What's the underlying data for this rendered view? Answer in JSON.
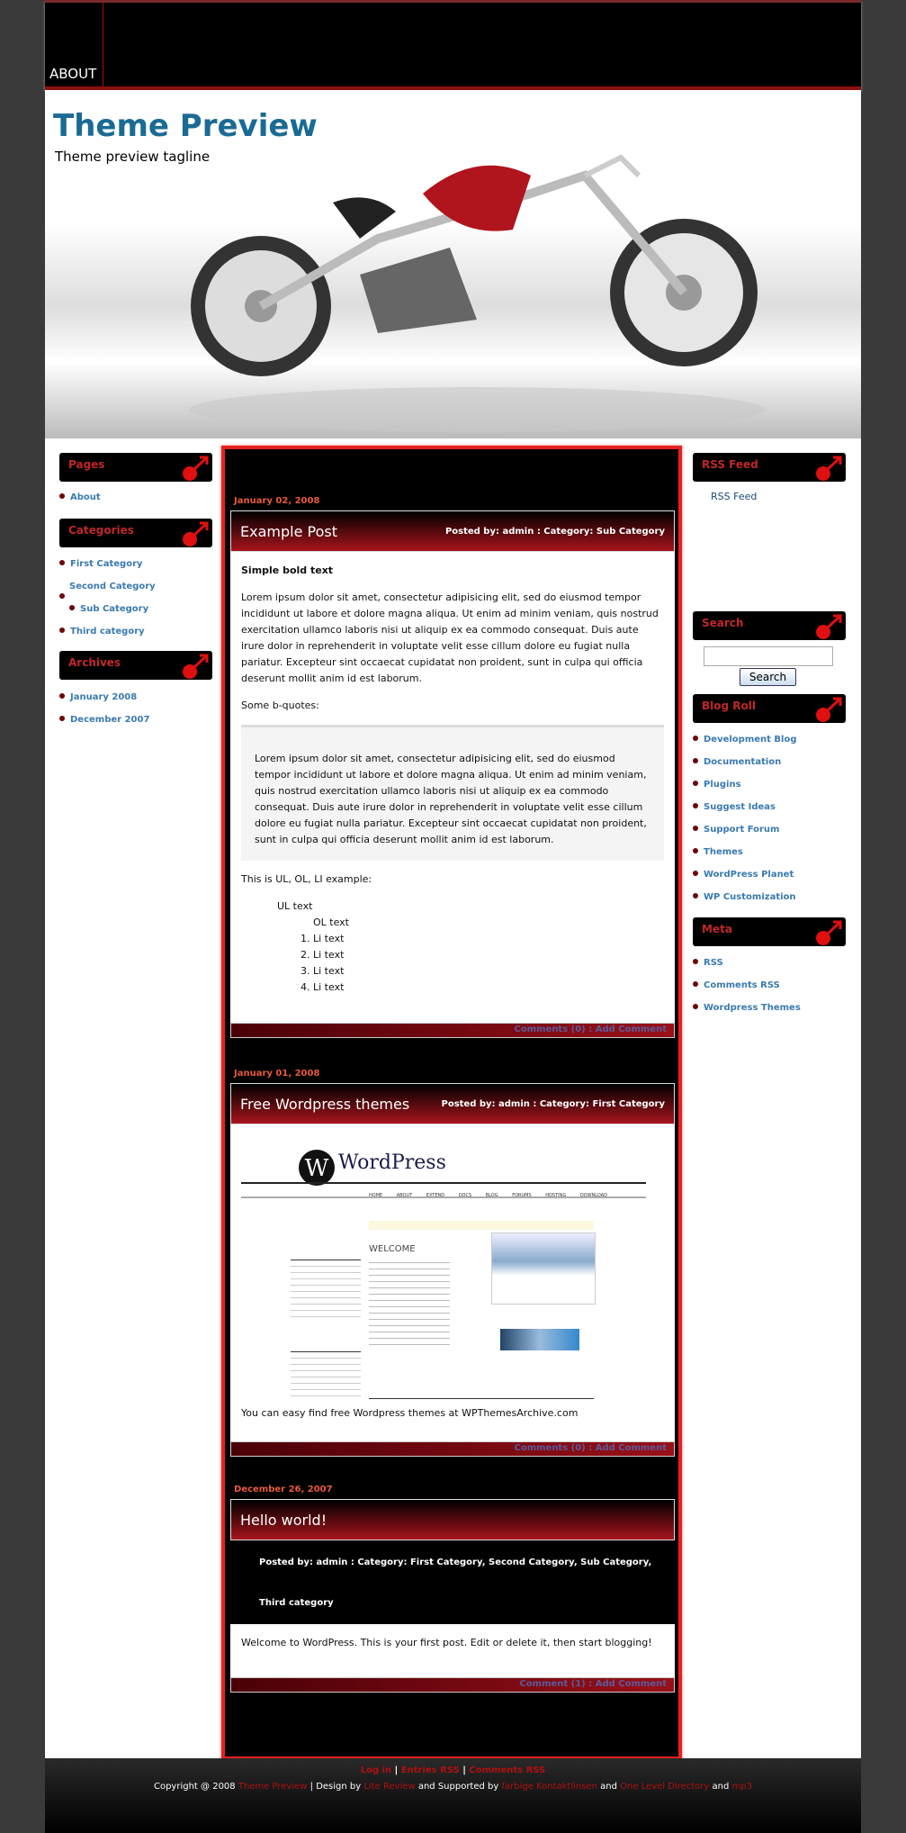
{
  "nav": {
    "about": "ABOUT"
  },
  "header": {
    "title": "Theme Preview",
    "tagline": "Theme preview tagline"
  },
  "left_sidebar": {
    "pages": {
      "title": "Pages",
      "items": [
        "About"
      ]
    },
    "categories": {
      "title": "Categories",
      "items": [
        "First Category",
        "Second Category",
        "Sub Category",
        "Third category"
      ]
    },
    "archives": {
      "title": "Archives",
      "items": [
        "January 2008",
        "December 2007"
      ]
    }
  },
  "right_sidebar": {
    "rss": {
      "title": "RSS Feed",
      "link": "RSS Feed"
    },
    "search": {
      "title": "Search",
      "input_value": "",
      "button": "Search"
    },
    "blogroll": {
      "title": "Blog Roll",
      "items": [
        "Development Blog",
        "Documentation",
        "Plugins",
        "Suggest Ideas",
        "Support Forum",
        "Themes",
        "WordPress Planet",
        "WP Customization"
      ]
    },
    "meta": {
      "title": "Meta",
      "items": [
        "RSS",
        "Comments RSS",
        "Wordpress Themes"
      ]
    }
  },
  "posts": [
    {
      "date": "January 02, 2008",
      "title": "Example Post",
      "meta": "Posted by: admin  :  Category: Sub Category",
      "bold": "Simple bold text",
      "p1": "Lorem ipsum dolor sit amet, consectetur adipisicing elit, sed do eiusmod tempor incididunt ut labore et dolore magna aliqua. Ut enim ad minim veniam, quis nostrud exercitation ullamco laboris nisi ut aliquip ex ea commodo consequat. Duis aute irure dolor in reprehenderit in voluptate velit esse cillum dolore eu fugiat nulla pariatur. Excepteur sint occaecat cupidatat non proident, sunt in culpa qui officia deserunt mollit anim id est laborum.",
      "p2": "Some b-quotes:",
      "quote": "Lorem ipsum dolor sit amet, consectetur adipisicing elit, sed do eiusmod tempor incididunt ut labore et dolore magna aliqua. Ut enim ad minim veniam, quis nostrud exercitation ullamco laboris nisi ut aliquip ex ea commodo consequat. Duis aute irure dolor in reprehenderit in voluptate velit esse cillum dolore eu fugiat nulla pariatur. Excepteur sint occaecat cupidatat non proident, sunt in culpa qui officia deserunt mollit anim id est laborum.",
      "p3": "This is UL, OL, LI example:",
      "ul": "UL text",
      "ol": "OL text",
      "li": [
        "Li text",
        "Li text",
        "Li text",
        "Li text"
      ],
      "comments": "Comments (0)",
      "add": "Add Comment"
    },
    {
      "date": "January 01, 2008",
      "title": "Free Wordpress themes",
      "meta": "Posted by: admin  :  Category: First Category",
      "image": {
        "logo": "WordPress",
        "nav": [
          "HOME",
          "ABOUT",
          "EXTEND",
          "DOCS",
          "BLOG",
          "FORUMS",
          "HOSTING",
          "DOWNLOAD"
        ],
        "welcome": "WELCOME"
      },
      "text": "You can easy find free Wordpress themes at WPThemesArchive.com",
      "comments": "Comments (0)",
      "add": "Add Comment"
    },
    {
      "date": "December 26, 2007",
      "title": "Hello world!",
      "meta1": "Posted by: admin  :  Category: First Category, Second Category, Sub Category,",
      "meta2": "Third category",
      "text": "Welcome to WordPress. This is your first post. Edit or delete it, then start blogging!",
      "comments": "Comment (1)",
      "add": "Add Comment"
    }
  ],
  "footer": {
    "links": [
      "Log in",
      "Entries RSS",
      "Comments RSS"
    ],
    "copyright": "Copyright @ 2008",
    "site": "Theme Preview",
    "design_by": "| Design by",
    "designer": "Lite Review",
    "supported": "and Supported by",
    "s1": "farbige Kontaktlinsen",
    "and": "and",
    "s2": "One Level Directory",
    "s3": "mp3"
  },
  "colors": {
    "accent": "#e82020",
    "title": "#1a6a94",
    "link": "#3a7ab0"
  }
}
